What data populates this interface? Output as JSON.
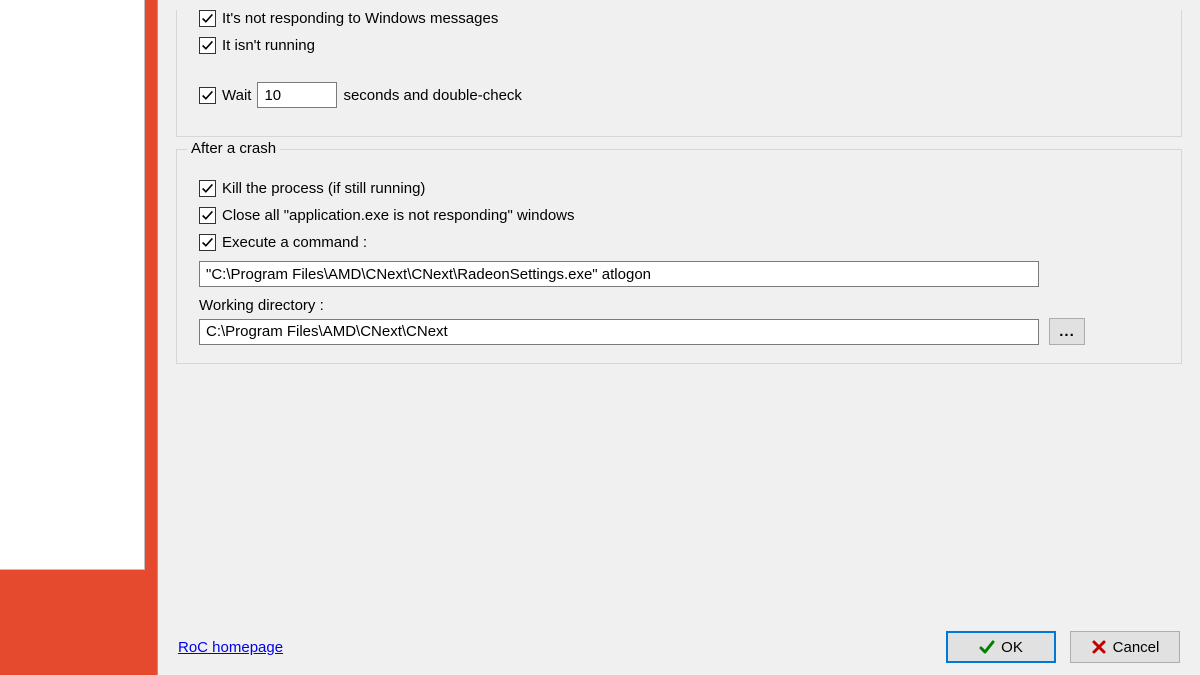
{
  "detection": {
    "not_responding_label": "It's not responding to Windows messages",
    "not_running_label": "It isn't running",
    "wait_label": "Wait",
    "wait_value": "10",
    "wait_suffix": "seconds and double-check"
  },
  "after_crash": {
    "legend": "After a crash",
    "kill_label": "Kill the process (if still running)",
    "close_windows_label": "Close all \"application.exe is not responding\" windows",
    "execute_label": "Execute a command :",
    "command_value": "\"C:\\Program Files\\AMD\\CNext\\CNext\\RadeonSettings.exe\" atlogon",
    "working_dir_label": "Working directory :",
    "working_dir_value": "C:\\Program Files\\AMD\\CNext\\CNext",
    "browse_label": "..."
  },
  "footer": {
    "link_label": "RoC homepage",
    "ok_label": "OK",
    "cancel_label": "Cancel"
  }
}
